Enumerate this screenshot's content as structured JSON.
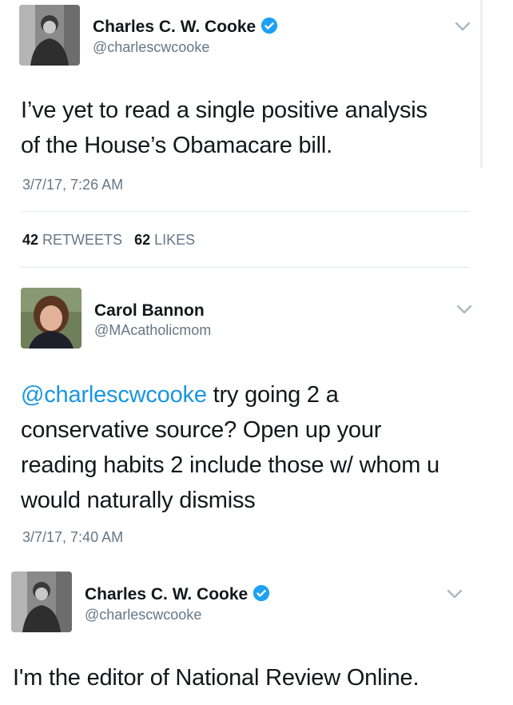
{
  "tweets": [
    {
      "author_name": "Charles C. W. Cooke",
      "handle": "@charlescwcooke",
      "verified": true,
      "text": "I've yet to read a single positive analysis of the House's Obamacare bill.",
      "line1": "I’ve yet to read a single positive analysis",
      "line2": "of the House’s Obamacare bill.",
      "timestamp": "3/7/17, 7:26 AM",
      "retweets_count": "42",
      "retweets_label": "RETWEETS",
      "likes_count": "62",
      "likes_label": "LIKES"
    },
    {
      "author_name": "Carol Bannon",
      "handle": "@MAcatholicmom",
      "verified": false,
      "mention": "@charlescwcooke",
      "line1_rest": " try going 2 a",
      "line2": "conservative source? Open up your",
      "line3": "reading habits 2 include those w/ whom u",
      "line4": "would naturally dismiss",
      "timestamp": "3/7/17, 7:40 AM"
    },
    {
      "author_name": "Charles C. W. Cooke",
      "handle": "@charlescwcooke",
      "verified": true,
      "text": "I'm the editor of National Review Online."
    }
  ],
  "colors": {
    "link": "#1b95e0",
    "secondary_text": "#657786",
    "verified_badge": "#1da1f2",
    "divider": "#e1e8ed"
  },
  "icons": [
    "verified-badge-icon",
    "chevron-down-icon"
  ]
}
